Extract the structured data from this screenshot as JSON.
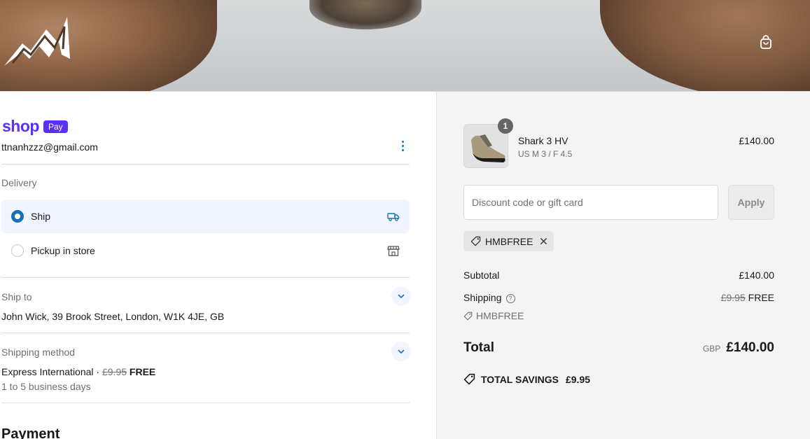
{
  "header": {
    "cart_icon": "shopping-bag-icon",
    "logo": "brand-mountain-logo"
  },
  "express": {
    "shop_word": "shop",
    "pay_badge": "Pay"
  },
  "contact": {
    "email": "ttnanhzzz@gmail.com",
    "menu_icon": "kebab-menu-icon"
  },
  "delivery": {
    "label": "Delivery",
    "options": [
      {
        "label": "Ship",
        "selected": true,
        "icon": "truck-icon"
      },
      {
        "label": "Pickup in store",
        "selected": false,
        "icon": "store-icon"
      }
    ]
  },
  "ship_to": {
    "label": "Ship to",
    "address": "John Wick, 39 Brook Street, London, W1K 4JE, GB"
  },
  "shipping_method": {
    "label": "Shipping method",
    "name": "Express International",
    "separator": " · ",
    "original_price": "£9.95",
    "price": "FREE",
    "eta": "1 to 5 business days"
  },
  "payment": {
    "heading": "Payment"
  },
  "order": {
    "item": {
      "quantity": "1",
      "name": "Shark 3 HV",
      "variant": "US M 3 / F 4.5",
      "price": "£140.00"
    },
    "discount": {
      "placeholder": "Discount code or gift card",
      "apply_label": "Apply"
    },
    "applied_code": "HMBFREE",
    "subtotal_label": "Subtotal",
    "subtotal": "£140.00",
    "shipping_label": "Shipping",
    "shipping_original": "£9.95",
    "shipping_price": "FREE",
    "shipping_code": "HMBFREE",
    "total_label": "Total",
    "currency": "GBP",
    "total": "£140.00",
    "savings_label": "TOTAL SAVINGS",
    "savings_amount": "£9.95"
  },
  "colors": {
    "accent": "#1773b0",
    "shop_pay": "#5a31f4",
    "summary_bg": "#f4f4f4"
  }
}
